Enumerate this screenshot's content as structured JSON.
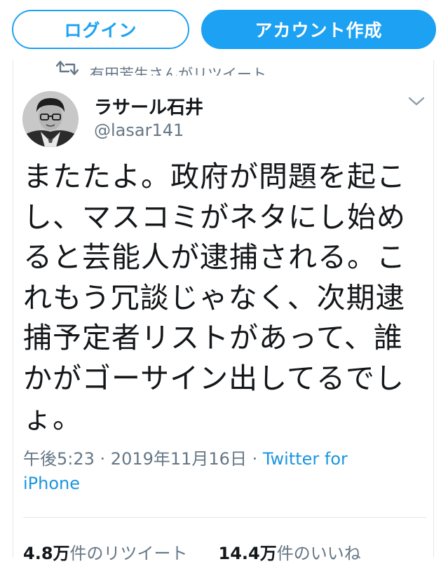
{
  "header": {
    "login_label": "ログイン",
    "signup_label": "アカウント作成",
    "accent_color": "#1da1f2"
  },
  "retweet_context": {
    "icon": "retweet-icon",
    "text": "有田芳生さんがリツイート"
  },
  "author": {
    "display_name": "ラサール石井",
    "handle": "@lasar141",
    "avatar": "avatar"
  },
  "tweet": {
    "text_lines": [
      "またたよ。政府が問題を起こ",
      "し、マスコミがネタにし始め",
      "ると芸能人が逮捕される。こ",
      "れもう冗談じゃなく、次期逮",
      "捕予定者リストがあって、誰",
      "かがゴーサイン出してるでし",
      "ょ。"
    ]
  },
  "meta": {
    "time": "午後5:23",
    "separator1": " · ",
    "date": "2019年11月16日",
    "separator2": " · ",
    "source_part1": "Twitter for",
    "source_part2": "iPhone",
    "link_color": "#1b95e0"
  },
  "stats": {
    "retweets_count": "4.8万",
    "retweets_label": "件のリツイート",
    "likes_count": "14.4万",
    "likes_label": "件のいいね"
  }
}
